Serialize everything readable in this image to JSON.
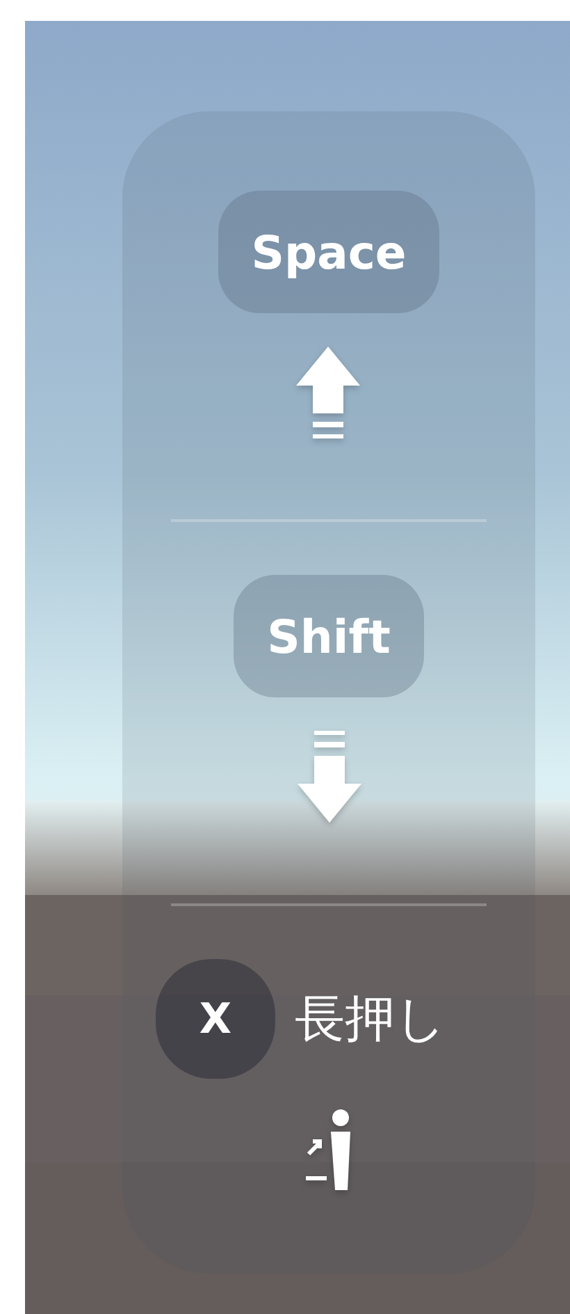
{
  "controls": [
    {
      "kind": "ascend",
      "key": "Space"
    },
    {
      "kind": "descend",
      "key": "Shift"
    },
    {
      "kind": "hold",
      "key": "X",
      "hint": "長押し"
    }
  ]
}
